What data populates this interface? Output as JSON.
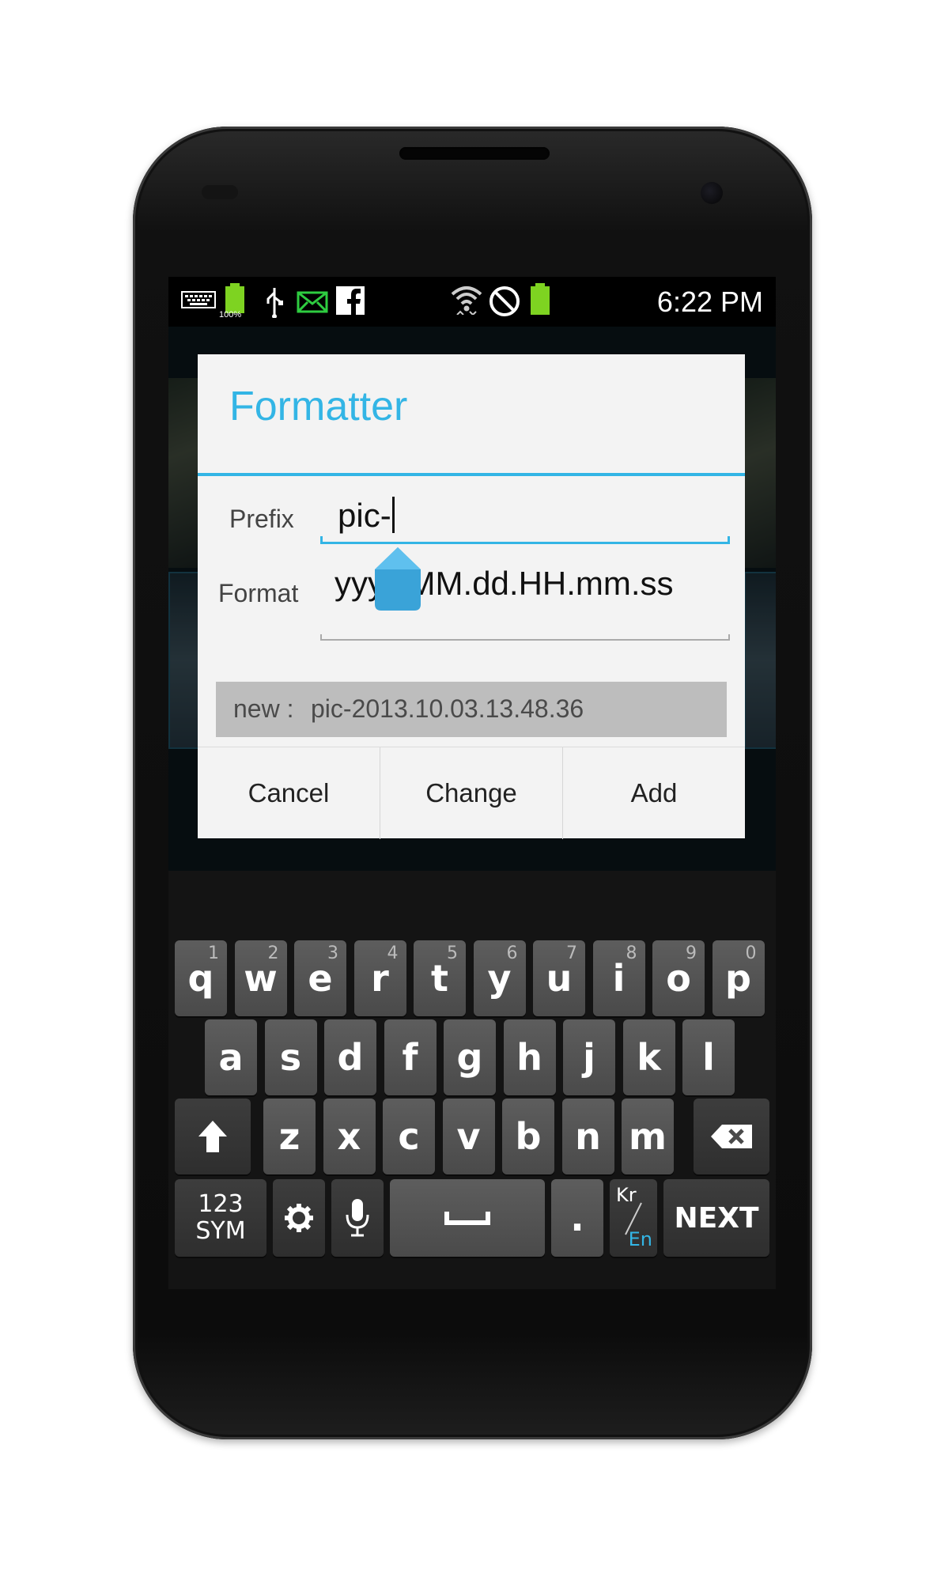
{
  "status_bar": {
    "time": "6:22 PM",
    "battery_badge": "100%",
    "icons": [
      "keyboard-icon",
      "battery-charging-icon",
      "usb-icon",
      "email-icon",
      "facebook-icon",
      "wifi-icon",
      "blocked-icon",
      "battery-icon"
    ]
  },
  "dialog": {
    "title": "Formatter",
    "prefix_label": "Prefix",
    "prefix_value": "pic-",
    "format_label": "Format",
    "format_value": "yyyy.MM.dd.HH.mm.ss",
    "preview_label": "new :",
    "preview_value": "pic-2013.10.03.13.48.36",
    "buttons": {
      "cancel": "Cancel",
      "change": "Change",
      "add": "Add"
    }
  },
  "keyboard": {
    "row1": [
      {
        "k": "q",
        "n": "1"
      },
      {
        "k": "w",
        "n": "2"
      },
      {
        "k": "e",
        "n": "3"
      },
      {
        "k": "r",
        "n": "4"
      },
      {
        "k": "t",
        "n": "5"
      },
      {
        "k": "y",
        "n": "6"
      },
      {
        "k": "u",
        "n": "7"
      },
      {
        "k": "i",
        "n": "8"
      },
      {
        "k": "o",
        "n": "9"
      },
      {
        "k": "p",
        "n": "0"
      }
    ],
    "row2": [
      "a",
      "s",
      "d",
      "f",
      "g",
      "h",
      "j",
      "k",
      "l"
    ],
    "row3": [
      "z",
      "x",
      "c",
      "v",
      "b",
      "n",
      "m"
    ],
    "sym_label": "123\nSYM",
    "period": ".",
    "lang_kr": "Kr",
    "lang_en": "En",
    "next_label": "NEXT"
  }
}
